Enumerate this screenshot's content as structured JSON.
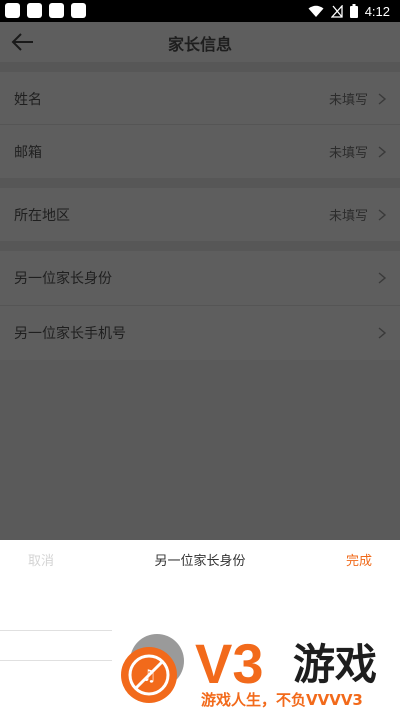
{
  "status_bar": {
    "time": "4:12"
  },
  "header": {
    "title": "家长信息"
  },
  "rows": [
    {
      "label": "姓名",
      "value": "未填写"
    },
    {
      "label": "邮箱",
      "value": "未填写"
    },
    {
      "label": "所在地区",
      "value": "未填写"
    },
    {
      "label": "另一位家长身份",
      "value": ""
    },
    {
      "label": "另一位家长手机号",
      "value": ""
    }
  ],
  "sheet": {
    "cancel_label": "取消",
    "title": "另一位家长身份",
    "done_label": "完成"
  },
  "watermark": {
    "brand": "V3游戏",
    "slogan": "游戏人生，不负VVVV3",
    "accent_color": "#f26a1b"
  },
  "colors": {
    "done": "#f06a1a",
    "overlay": "#5a5a5a"
  }
}
